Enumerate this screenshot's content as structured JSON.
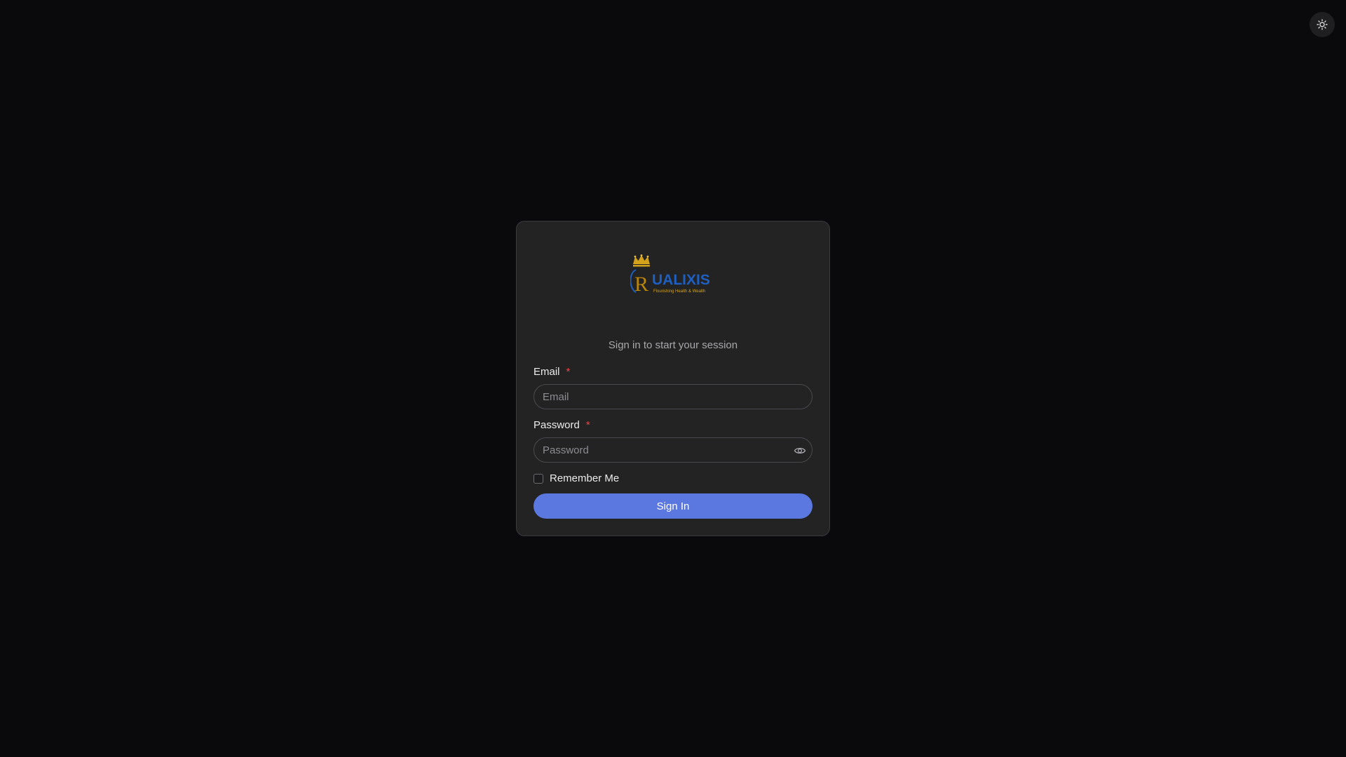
{
  "theme_toggle": {
    "icon": "sun-icon"
  },
  "logo": {
    "initial": "R",
    "name": "UALIXIS",
    "tagline": "Flourishing Health & Wealth",
    "colors": {
      "crown": "#d4a21a",
      "initial": "#b8860b",
      "name": "#1f5fbf",
      "tagline": "#d4a21a"
    }
  },
  "login": {
    "subtitle": "Sign in to start your session",
    "email": {
      "label": "Email",
      "required_mark": "*",
      "placeholder": "Email",
      "value": ""
    },
    "password": {
      "label": "Password",
      "required_mark": "*",
      "placeholder": "Password",
      "value": "",
      "toggle_icon": "eye-icon"
    },
    "remember_me": {
      "label": "Remember Me",
      "checked": false
    },
    "submit_label": "Sign In"
  },
  "colors": {
    "background": "#0a090b",
    "card": "#232323",
    "accent": "#5a78e0",
    "required": "#e5484d"
  }
}
